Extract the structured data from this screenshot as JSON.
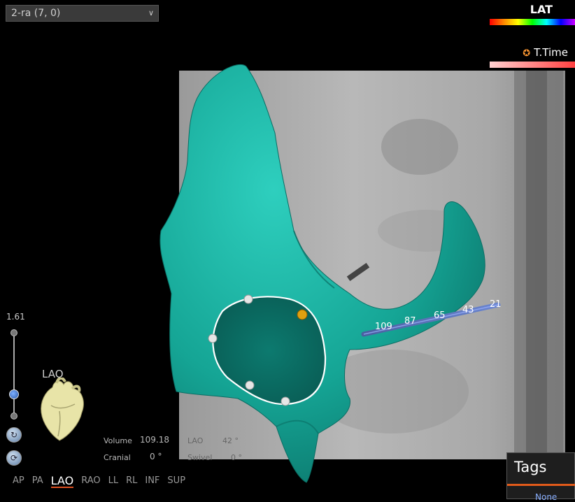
{
  "map_selector": {
    "value": "2-ra (7, 0)"
  },
  "legend": {
    "lat_label": "LAT",
    "ttime_label": "T.Time"
  },
  "zoom": {
    "value": "1.61"
  },
  "orientation": {
    "label": "LAO"
  },
  "catheter": {
    "electrode_labels": [
      "109",
      "87",
      "65",
      "43",
      "21"
    ]
  },
  "stats": {
    "volume_label": "Volume",
    "volume_value": "109.18",
    "lao_label": "LAO",
    "lao_value": "42 °",
    "cranial_label": "Cranial",
    "cranial_value": "0 °",
    "swivel_label": "Swivel",
    "swivel_value": "0 °"
  },
  "view_presets": [
    "AP",
    "PA",
    "LAO",
    "RAO",
    "LL",
    "RL",
    "INF",
    "SUP"
  ],
  "active_view": "LAO",
  "tags": {
    "title": "Tags",
    "value": "None"
  },
  "colors": {
    "chamber": "#1aa69a",
    "accent": "#e05a1a",
    "loop": "#ffffff"
  }
}
